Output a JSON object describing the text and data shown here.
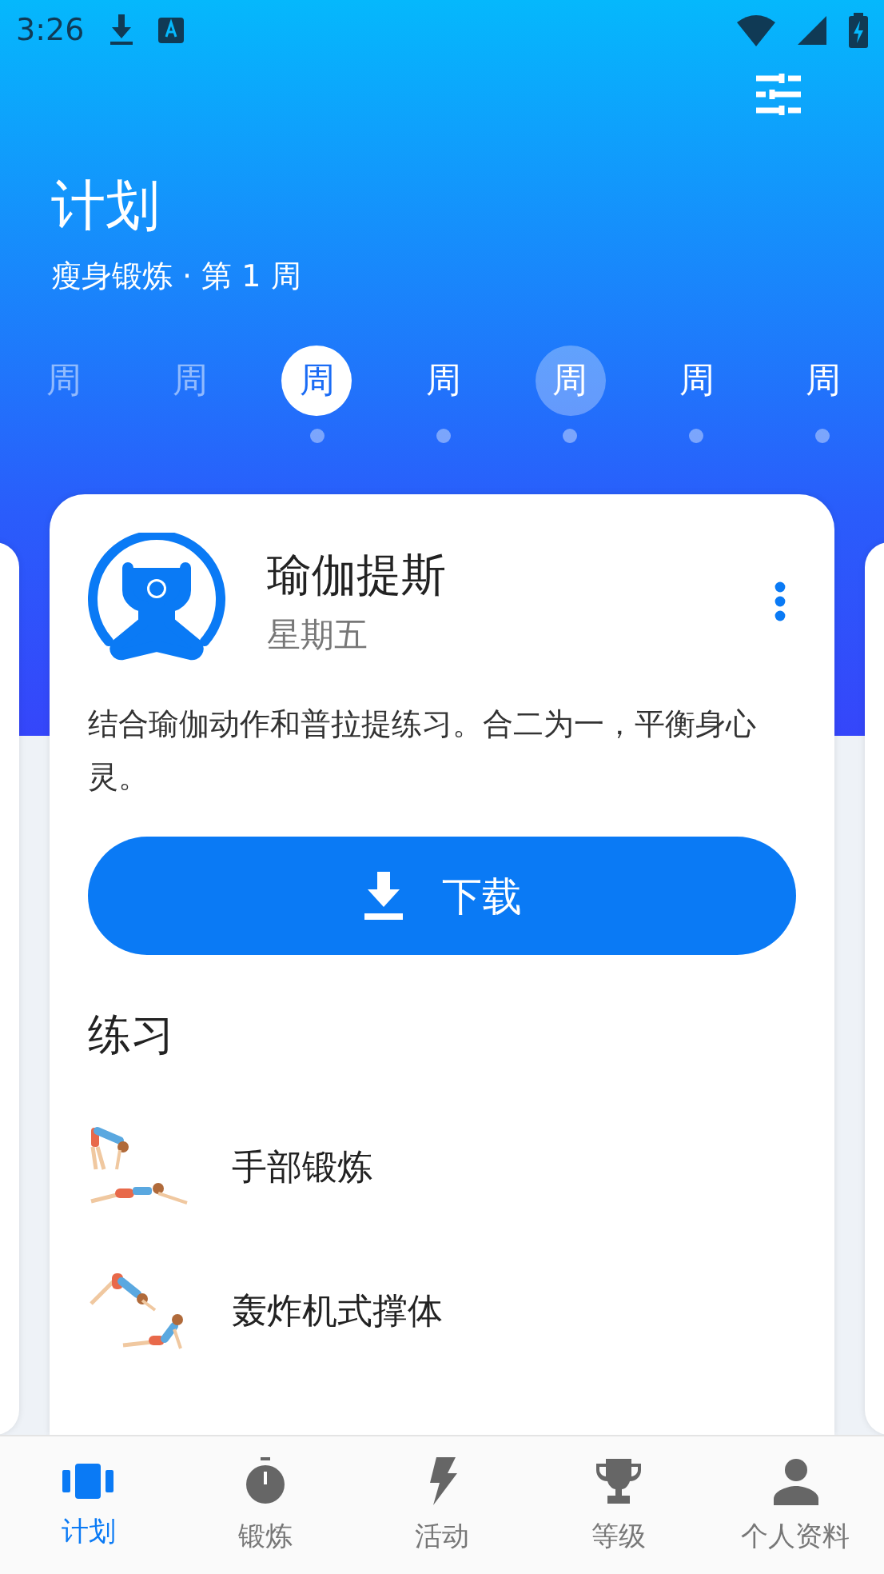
{
  "status_bar": {
    "time": "3:26"
  },
  "header": {
    "title": "计划",
    "subtitle": "瘦身锻炼 · 第 1 周"
  },
  "week": [
    {
      "label": "周",
      "selected": false,
      "past": true,
      "today": false,
      "has_workout": false
    },
    {
      "label": "周",
      "selected": false,
      "past": true,
      "today": false,
      "has_workout": false
    },
    {
      "label": "周",
      "selected": true,
      "past": false,
      "today": false,
      "has_workout": true
    },
    {
      "label": "周",
      "selected": false,
      "past": false,
      "today": false,
      "has_workout": true
    },
    {
      "label": "周",
      "selected": false,
      "past": false,
      "today": true,
      "has_workout": true
    },
    {
      "label": "周",
      "selected": false,
      "past": false,
      "today": false,
      "has_workout": true
    },
    {
      "label": "周",
      "selected": false,
      "past": false,
      "today": false,
      "has_workout": true
    }
  ],
  "card": {
    "title": "瑜伽提斯",
    "day": "星期五",
    "description": "结合瑜伽动作和普拉提练习。合二为一，平衡身心灵。",
    "button": "下载",
    "section_title": "练习",
    "exercises": [
      {
        "name": "手部锻炼"
      },
      {
        "name": "轰炸机式撑体"
      }
    ]
  },
  "bottom_nav": [
    {
      "label": "计划",
      "kind": "plan",
      "selected": true
    },
    {
      "label": "锻炼",
      "kind": "timer",
      "selected": false
    },
    {
      "label": "活动",
      "kind": "bolt",
      "selected": false
    },
    {
      "label": "等级",
      "kind": "trophy",
      "selected": false
    },
    {
      "label": "个人资料",
      "kind": "person",
      "selected": false
    }
  ]
}
